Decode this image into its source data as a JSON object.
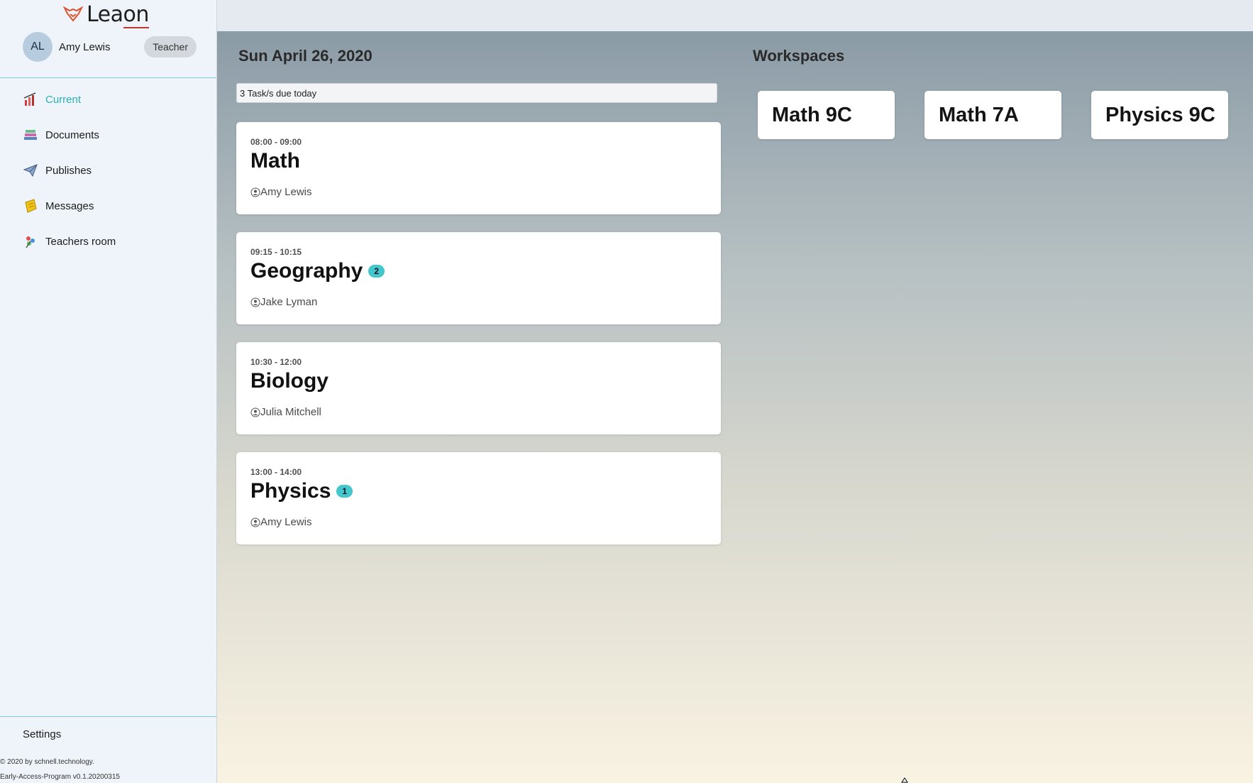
{
  "app": {
    "logo_text_a": "Lea",
    "logo_text_b": "on"
  },
  "user": {
    "initials": "AL",
    "name": "Amy Lewis",
    "role": "Teacher"
  },
  "nav": {
    "items": [
      {
        "label": "Current",
        "icon": "chart-icon"
      },
      {
        "label": "Documents",
        "icon": "books-icon"
      },
      {
        "label": "Publishes",
        "icon": "paper-plane-icon"
      },
      {
        "label": "Messages",
        "icon": "note-icon"
      },
      {
        "label": "Teachers room",
        "icon": "palette-icon"
      }
    ],
    "settings": "Settings"
  },
  "footer": {
    "copyright": "© 2020 by schnell.technology.",
    "version": "Early-Access-Program v0.1.20200315"
  },
  "schedule": {
    "date": "Sun April 26, 2020",
    "tasks_due": "3 Task/s due today",
    "lessons": [
      {
        "time": "08:00 - 09:00",
        "subject": "Math",
        "badge": "",
        "teacher": "Amy Lewis"
      },
      {
        "time": "09:15 - 10:15",
        "subject": "Geography",
        "badge": "2",
        "teacher": "Jake Lyman"
      },
      {
        "time": "10:30 - 12:00",
        "subject": "Biology",
        "badge": "",
        "teacher": "Julia Mitchell"
      },
      {
        "time": "13:00 - 14:00",
        "subject": "Physics",
        "badge": "1",
        "teacher": "Amy Lewis"
      }
    ]
  },
  "workspaces": {
    "title": "Workspaces",
    "items": [
      "Math 9C",
      "Math 7A",
      "Physics 9C"
    ]
  },
  "colors": {
    "accent": "#2ab0b8",
    "badge": "#43c6cc",
    "sidebar_bg": "#eef4f9",
    "logo_accent": "#c0392b"
  }
}
